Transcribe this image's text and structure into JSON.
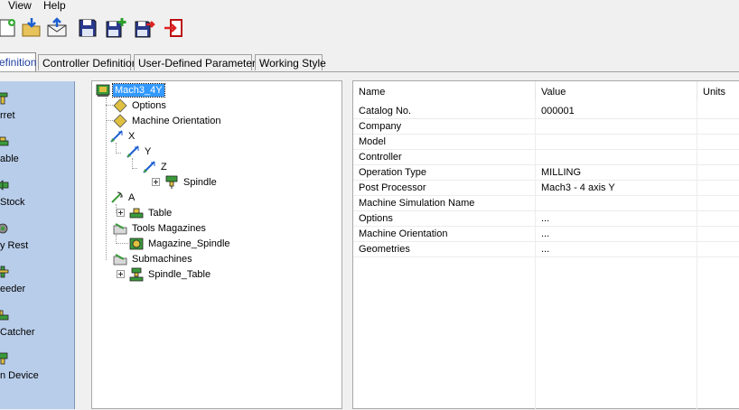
{
  "menu": {
    "view": "View",
    "help": "Help"
  },
  "toolbar": [
    "new-file-icon",
    "open-folder-icon",
    "import-icon",
    "mail-icon",
    "save-icon",
    "save-add-icon",
    "save-export-icon",
    "exit-icon"
  ],
  "tabs": [
    {
      "label": "efinition",
      "active": true
    },
    {
      "label": "Controller Definition",
      "active": false
    },
    {
      "label": "User-Defined Parameters",
      "active": false
    },
    {
      "label": "Working Style",
      "active": false
    }
  ],
  "left_panel": {
    "items": [
      {
        "label": "rret",
        "icon": "turret-icon"
      },
      {
        "label": "able",
        "icon": "table-icon"
      },
      {
        "label": "Stock",
        "icon": "stock-icon"
      },
      {
        "label": "y Rest",
        "icon": "steady-rest-icon"
      },
      {
        "label": "eeder",
        "icon": "bar-feeder-icon"
      },
      {
        "label": "Catcher",
        "icon": "part-catcher-icon"
      },
      {
        "label": "n Device",
        "icon": "clamping-device-icon"
      }
    ]
  },
  "tree": {
    "root": "Mach3_4Y",
    "options": "Options",
    "orientation": "Machine Orientation",
    "x": "X",
    "y": "Y",
    "z": "Z",
    "spindle": "Spindle",
    "a": "A",
    "table": "Table",
    "tools_magazines": "Tools Magazines",
    "magazine_spindle": "Magazine_Spindle",
    "submachines": "Submachines",
    "spindle_table": "Spindle_Table"
  },
  "grid": {
    "headers": {
      "name": "Name",
      "value": "Value",
      "units": "Units"
    },
    "rows": [
      {
        "name": "Catalog No.",
        "value": "000001"
      },
      {
        "name": "Company",
        "value": ""
      },
      {
        "name": "Model",
        "value": ""
      },
      {
        "name": "Controller",
        "value": ""
      },
      {
        "name": "Operation Type",
        "value": "MILLING"
      },
      {
        "name": "Post Processor",
        "value": "Mach3 - 4 axis Y"
      },
      {
        "name": "Machine Simulation Name",
        "value": ""
      },
      {
        "name": "Options",
        "value": "..."
      },
      {
        "name": "Machine Orientation",
        "value": "..."
      },
      {
        "name": "Geometries",
        "value": "..."
      }
    ]
  },
  "colors": {
    "selection": "#3399ff",
    "panel": "#b8cdea",
    "active_tab_text": "#1f3ea0"
  }
}
